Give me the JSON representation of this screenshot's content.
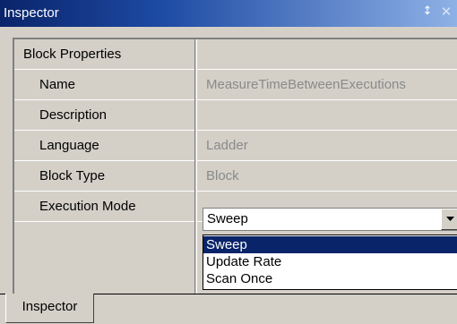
{
  "window": {
    "title": "Inspector",
    "pin_icon": "pin-icon",
    "close_icon": "close-icon"
  },
  "properties": {
    "category": "Block Properties",
    "rows": [
      {
        "name": "Name",
        "value": "MeasureTimeBetweenExecutions"
      },
      {
        "name": "Description",
        "value": ""
      },
      {
        "name": "Language",
        "value": "Ladder"
      },
      {
        "name": "Block Type",
        "value": "Block"
      },
      {
        "name": "Execution Mode",
        "value": "Sweep"
      }
    ]
  },
  "execution_mode_dropdown": {
    "selected": "Sweep",
    "options": [
      "Sweep",
      "Update Rate",
      "Scan Once"
    ],
    "highlighted_index": 0
  },
  "tabs": [
    {
      "label": "Inspector",
      "active": true
    }
  ]
}
